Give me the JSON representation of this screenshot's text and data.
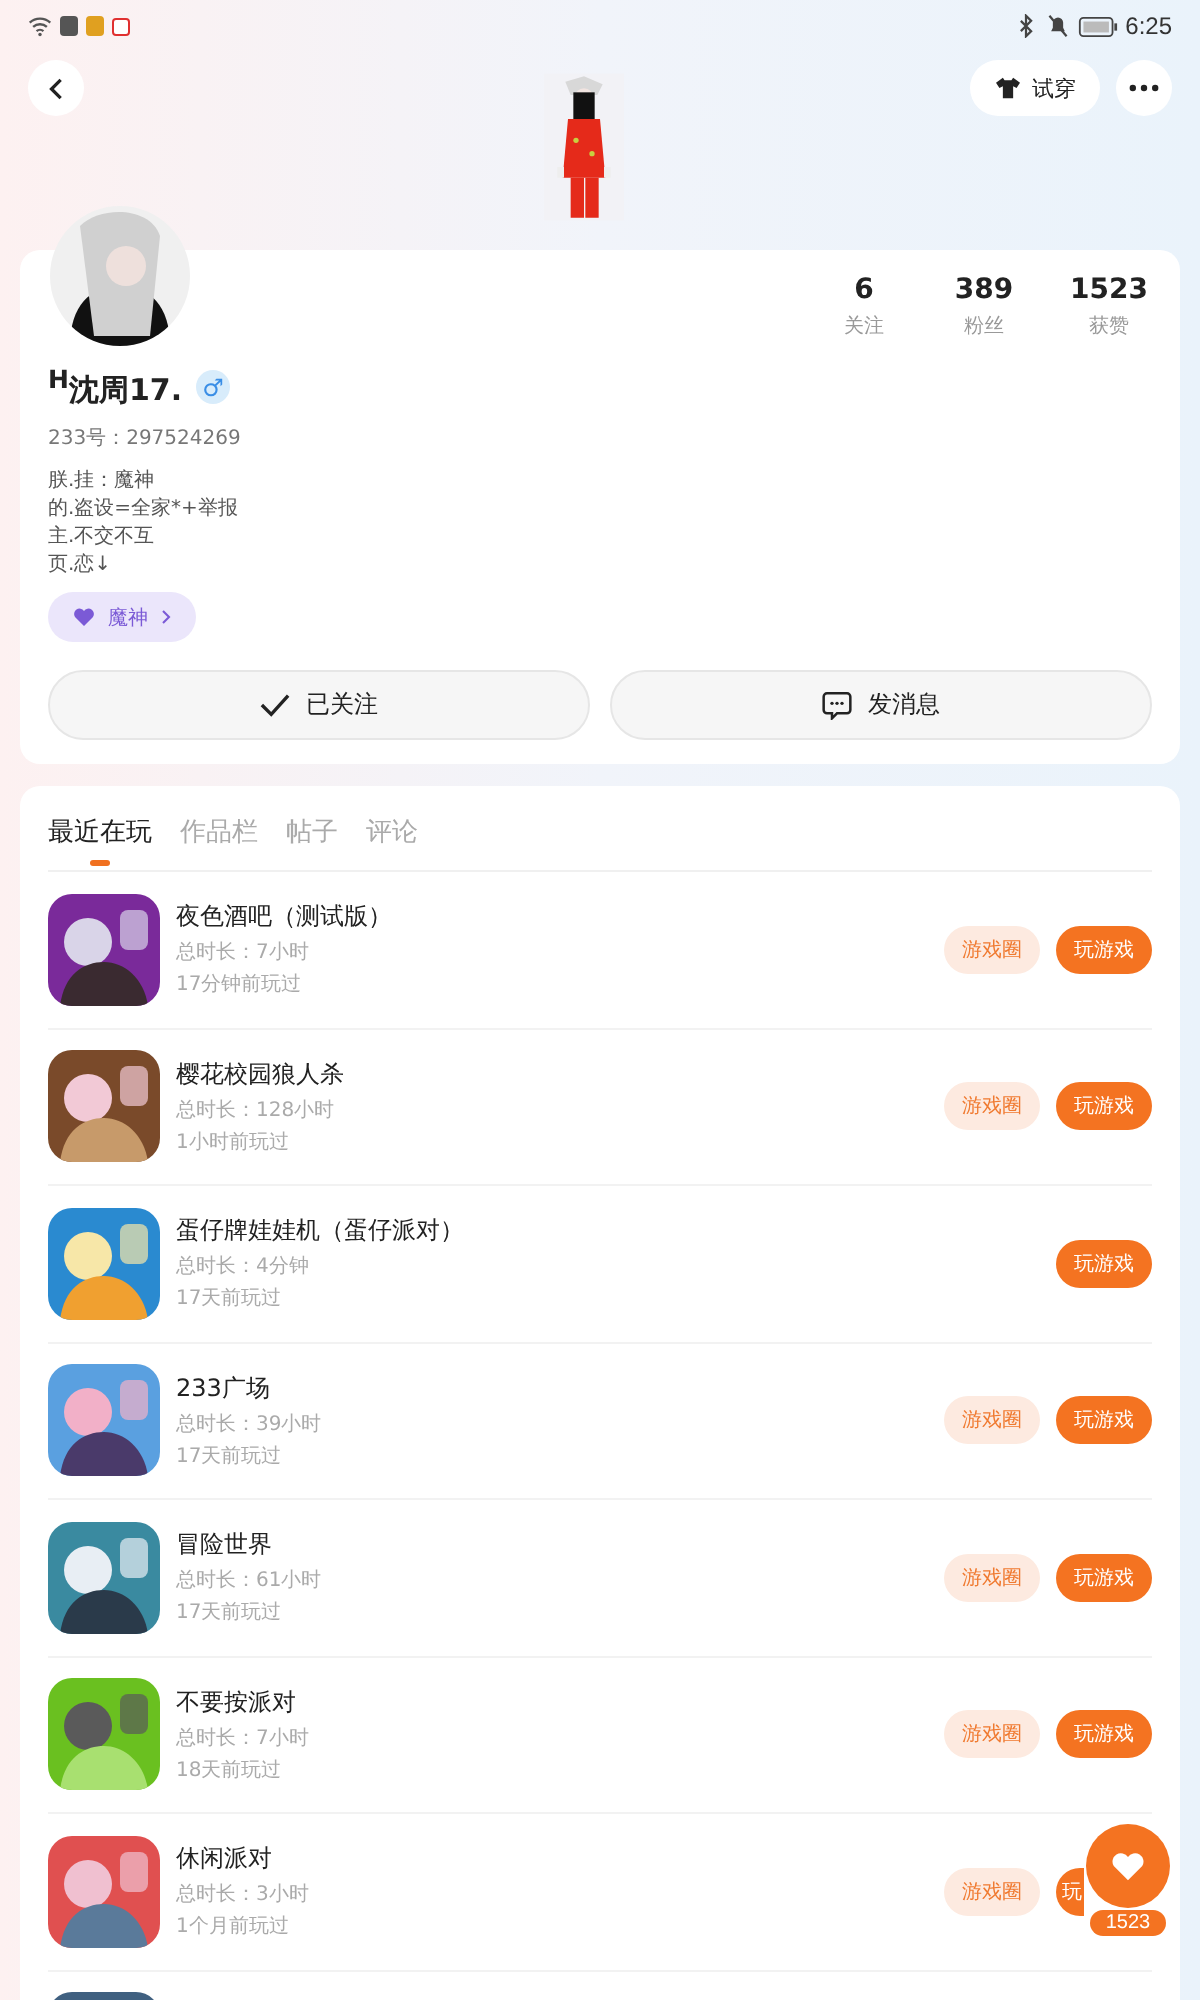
{
  "status_bar": {
    "time": "6:25"
  },
  "header": {
    "try_on": "试穿"
  },
  "profile": {
    "name": "$^{H}$沈周17.",
    "gender": "♂",
    "id_line": "233号：297524269",
    "bio": [
      "朕.挂：魔神",
      "的.盗设=全家*+举报",
      "主.不交不互",
      "页.恋↓"
    ],
    "tag": "魔神",
    "stats": [
      {
        "value": "6",
        "label": "关注"
      },
      {
        "value": "389",
        "label": "粉丝"
      },
      {
        "value": "1523",
        "label": "获赞"
      }
    ],
    "follow_button": "已关注",
    "message_button": "发消息"
  },
  "tabs": [
    {
      "label": "最近在玩",
      "selected": true
    },
    {
      "label": "作品栏",
      "selected": false
    },
    {
      "label": "帖子",
      "selected": false
    },
    {
      "label": "评论",
      "selected": false
    }
  ],
  "games": [
    {
      "kind": "game",
      "title": "夜色酒吧（测试版）",
      "duration": "总时长：7小时",
      "last_played": "17分钟前玩过",
      "circle_button": "游戏圈",
      "play_button": "玩游戏",
      "covered": false
    },
    {
      "kind": "game",
      "title": "樱花校园狼人杀",
      "duration": "总时长：128小时",
      "last_played": "1小时前玩过",
      "circle_button": "游戏圈",
      "play_button": "玩游戏",
      "covered": false
    },
    {
      "kind": "game",
      "title": "蛋仔牌娃娃机（蛋仔派对）",
      "duration": "总时长：4分钟",
      "last_played": "17天前玩过",
      "play_button": "玩游戏",
      "covered": false
    },
    {
      "kind": "game",
      "title": "233广场",
      "duration": "总时长：39小时",
      "last_played": "17天前玩过",
      "circle_button": "游戏圈",
      "play_button": "玩游戏",
      "covered": false
    },
    {
      "kind": "game",
      "title": "冒险世界",
      "duration": "总时长：61小时",
      "last_played": "17天前玩过",
      "circle_button": "游戏圈",
      "play_button": "玩游戏",
      "covered": false
    },
    {
      "kind": "game",
      "title": "不要按派对",
      "duration": "总时长：7小时",
      "last_played": "18天前玩过",
      "circle_button": "游戏圈",
      "play_button": "玩游戏",
      "covered": false
    },
    {
      "kind": "game",
      "title": "休闲派对",
      "duration": "总时长：3小时",
      "last_played": "1个月前玩过",
      "circle_button": "游戏圈",
      "play_button": "玩",
      "covered": true
    },
    {
      "kind": "picture"
    }
  ],
  "like_fab": {
    "count": "1523"
  }
}
